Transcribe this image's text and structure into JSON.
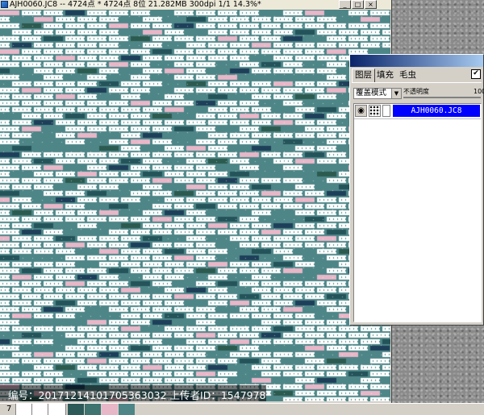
{
  "document_window": {
    "title": "AJH0060.JC8 -- 4724点 * 4724点 8位  21.282MB 300dpi 1/1  14.3%*",
    "buttons": {
      "minimize": "_",
      "maximize": "□",
      "close": "×"
    }
  },
  "watermark": {
    "text": "编号：20171214101705363032 上传者ID：1547978"
  },
  "status_bar": {
    "left_value": "7",
    "swatch_colors": [
      "#2c5a59",
      "#3f7370",
      "#e7b7c8",
      "#4e8688"
    ]
  },
  "layers_panel": {
    "tabs": [
      {
        "label": "图层",
        "active": true
      },
      {
        "label": "填充",
        "active": false
      },
      {
        "label": "毛虫",
        "active": false
      }
    ],
    "checkbox_mark": "✔",
    "blend_mode": "覆盖模式",
    "opacity_label": "不透明度",
    "opacity_value": "100",
    "layer": {
      "visible_icon": "eye-icon",
      "name": "AJH0060.JC8"
    }
  },
  "pattern": {
    "colors": {
      "base": "#4e8688",
      "white": "#ffffff",
      "pink": "#e7b7c8",
      "dark_teal": "#24535a",
      "navy": "#1e3f59",
      "deep_green": "#2c5a4f"
    }
  },
  "palette": {
    "stone": "#8a8a8a",
    "selection_blue": "#0000ff",
    "chrome": "#d4d0c8"
  }
}
